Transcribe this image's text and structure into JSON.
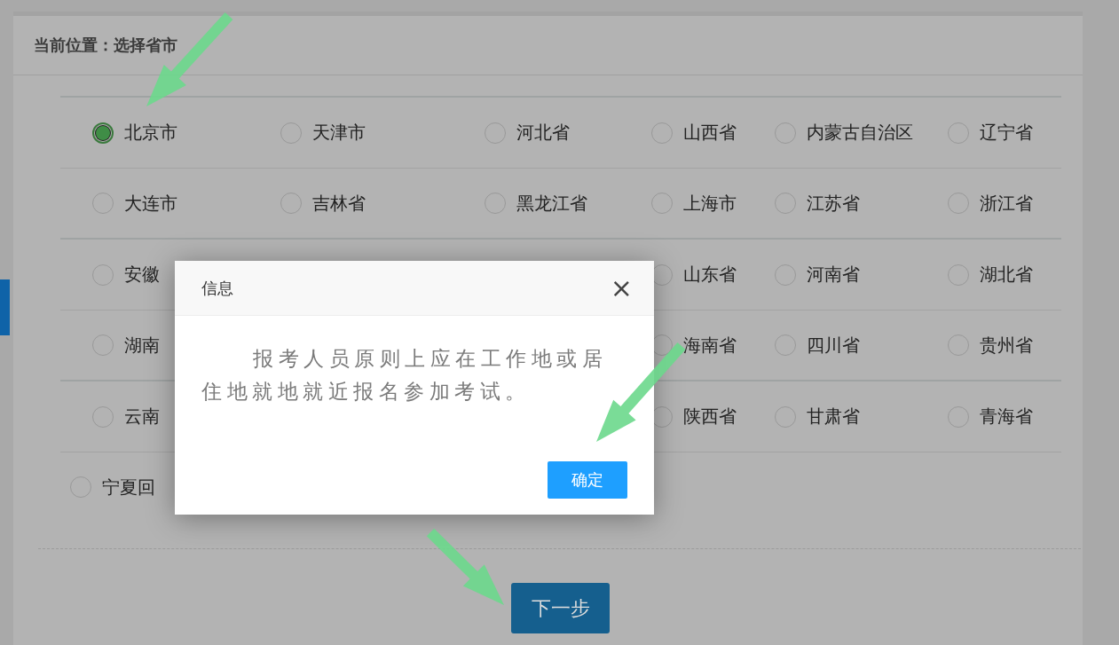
{
  "breadcrumb": {
    "label": "当前位置：",
    "value": "选择省市"
  },
  "province_rows": [
    {
      "items": [
        {
          "label": "北京市",
          "selected": true
        },
        {
          "label": "天津市",
          "selected": false
        },
        {
          "label": "河北省",
          "selected": false
        },
        {
          "label": "山西省",
          "selected": false
        },
        {
          "label": "内蒙古自治区",
          "selected": false
        },
        {
          "label": "辽宁省",
          "selected": false
        }
      ]
    },
    {
      "items": [
        {
          "label": "大连市",
          "selected": false
        },
        {
          "label": "吉林省",
          "selected": false
        },
        {
          "label": "黑龙江省",
          "selected": false
        },
        {
          "label": "上海市",
          "selected": false
        },
        {
          "label": "江苏省",
          "selected": false
        },
        {
          "label": "浙江省",
          "selected": false
        }
      ]
    },
    {
      "items": [
        {
          "label": "安徽",
          "selected": false
        },
        {
          "label": "山东省",
          "selected": false
        },
        {
          "label": "河南省",
          "selected": false
        },
        {
          "label": "湖北省",
          "selected": false
        }
      ]
    },
    {
      "items": [
        {
          "label": "湖南",
          "selected": false
        },
        {
          "label": "海南省",
          "selected": false
        },
        {
          "label": "四川省",
          "selected": false
        },
        {
          "label": "贵州省",
          "selected": false
        }
      ]
    },
    {
      "items": [
        {
          "label": "云南",
          "selected": false
        },
        {
          "label": "陕西省",
          "selected": false
        },
        {
          "label": "甘肃省",
          "selected": false
        },
        {
          "label": "青海省",
          "selected": false
        }
      ]
    }
  ],
  "extra_items": [
    {
      "label": "宁夏回",
      "selected": false
    }
  ],
  "next_button": "下一步",
  "dialog": {
    "title": "信息",
    "close": "×",
    "message": "报考人员原则上应在工作地或居住地就地就近报名参加考试。",
    "ok_button": "确定"
  }
}
